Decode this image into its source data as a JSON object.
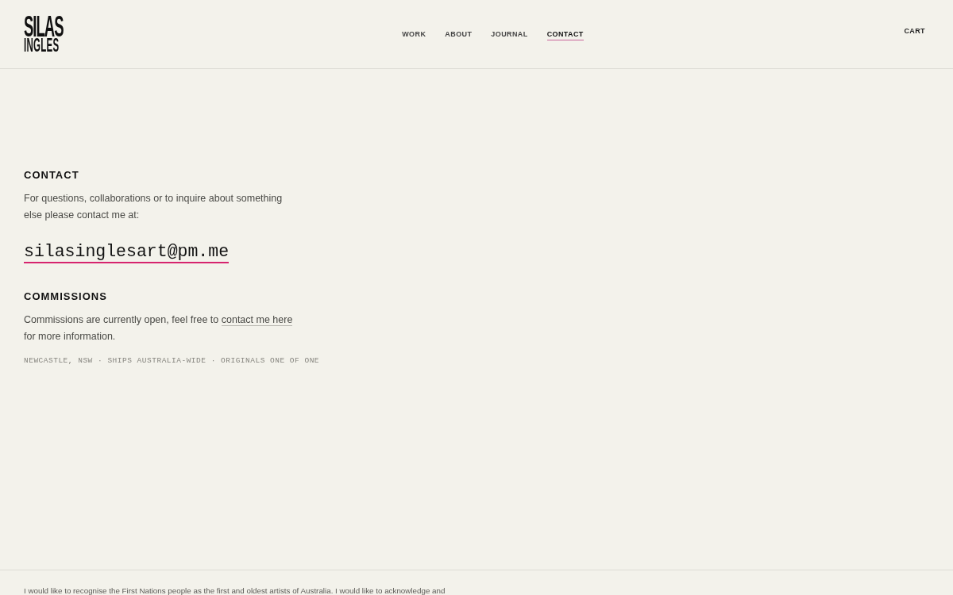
{
  "header": {
    "logo": {
      "line_1": "SILAS",
      "line_2": "INGLES"
    },
    "nav": [
      {
        "label": "WORK",
        "selected": false
      },
      {
        "label": "ABOUT",
        "selected": false
      },
      {
        "label": "JOURNAL",
        "selected": false
      },
      {
        "label": "CONTACT",
        "selected": true
      }
    ],
    "cart": "CART"
  },
  "contact": {
    "heading": "CONTACT",
    "text": "For questions, collaborations or to inquire about something else please contact me at:",
    "email": "silasinglesart@pm.me"
  },
  "commissions": {
    "heading": "COMMISSIONS",
    "text_before": "Commissions are currently open, feel free to",
    "link": "contact me here",
    "text_after": "for more information."
  },
  "tagline": "NEWCASTLE, NSW · SHIPS AUSTRALIA-WIDE · ORIGINALS ONE OF ONE",
  "footer": {
    "text": "I would like to recognise the First Nations people as the first and oldest artists of Australia. I would like to acknowledge and"
  }
}
